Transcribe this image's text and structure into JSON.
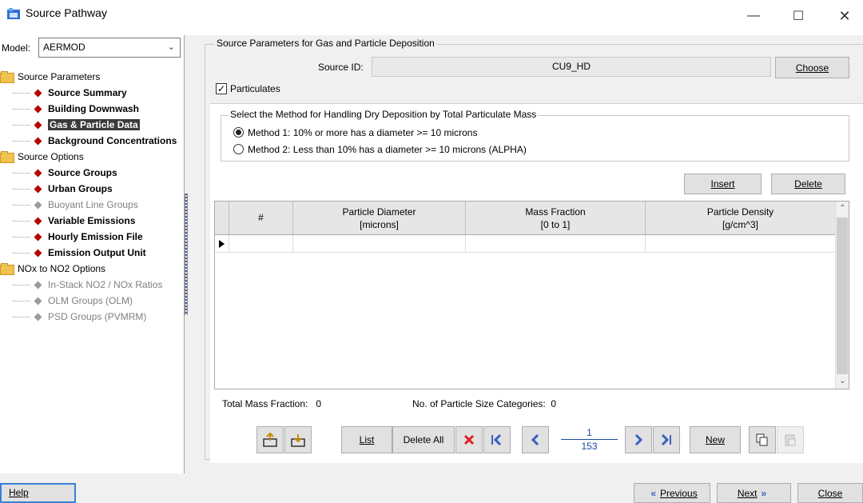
{
  "window": {
    "title": "Source Pathway"
  },
  "model": {
    "label": "Model:",
    "value": "AERMOD"
  },
  "tree": {
    "groups": [
      {
        "label": "Source Parameters",
        "items": [
          {
            "label": "Source Summary",
            "enabled": true,
            "selected": false
          },
          {
            "label": "Building Downwash",
            "enabled": true,
            "selected": false
          },
          {
            "label": "Gas & Particle Data",
            "enabled": true,
            "selected": true
          },
          {
            "label": "Background Concentrations",
            "enabled": true,
            "selected": false
          }
        ]
      },
      {
        "label": "Source Options",
        "items": [
          {
            "label": "Source Groups",
            "enabled": true,
            "selected": false
          },
          {
            "label": "Urban Groups",
            "enabled": true,
            "selected": false
          },
          {
            "label": "Buoyant Line Groups",
            "enabled": false,
            "selected": false
          },
          {
            "label": "Variable Emissions",
            "enabled": true,
            "selected": false
          },
          {
            "label": "Hourly Emission File",
            "enabled": true,
            "selected": false
          },
          {
            "label": "Emission Output Unit",
            "enabled": true,
            "selected": false
          }
        ]
      },
      {
        "label": "NOx to NO2 Options",
        "items": [
          {
            "label": "In-Stack NO2 / NOx Ratios",
            "enabled": false,
            "selected": false
          },
          {
            "label": "OLM Groups (OLM)",
            "enabled": false,
            "selected": false
          },
          {
            "label": "PSD Groups (PVMRM)",
            "enabled": false,
            "selected": false
          }
        ]
      }
    ]
  },
  "main": {
    "group_title": "Source Parameters for Gas and Particle Deposition",
    "source_id_label": "Source ID:",
    "source_id_value": "CU9_HD",
    "choose_label": "Choose",
    "particulates_label": "Particulates",
    "particulates_checked": true,
    "method_title": "Select the Method for Handling Dry Deposition by Total Particulate Mass",
    "method1_label": "Method 1: 10% or more has a diameter >= 10 microns",
    "method2_label": "Method 2: Less than 10% has a diameter >= 10 microns (ALPHA)",
    "selected_method": 1,
    "insert_label": "Insert",
    "delete_label": "Delete"
  },
  "grid": {
    "columns": [
      {
        "line1": "#",
        "line2": ""
      },
      {
        "line1": "Particle Diameter",
        "line2": "[microns]"
      },
      {
        "line1": "Mass Fraction",
        "line2": "[0 to 1]"
      },
      {
        "line1": "Particle Density",
        "line2": "[g/cm^3]"
      }
    ],
    "rows": []
  },
  "status": {
    "total_label": "Total Mass Fraction:",
    "total_value": "0",
    "cats_label": "No. of Particle Size Categories:",
    "cats_value": "0"
  },
  "navbar": {
    "list_label": "List",
    "delete_all_label": "Delete All",
    "new_label": "New",
    "record_current": "1",
    "record_total": "153"
  },
  "footer": {
    "help_label": "Help",
    "previous_label": "Previous",
    "next_label": "Next",
    "close_label": "Close"
  },
  "colors": {
    "accent_blue": "#3a5fc0",
    "tree_bullet": "#b30000",
    "delete_x": "#e02020"
  }
}
